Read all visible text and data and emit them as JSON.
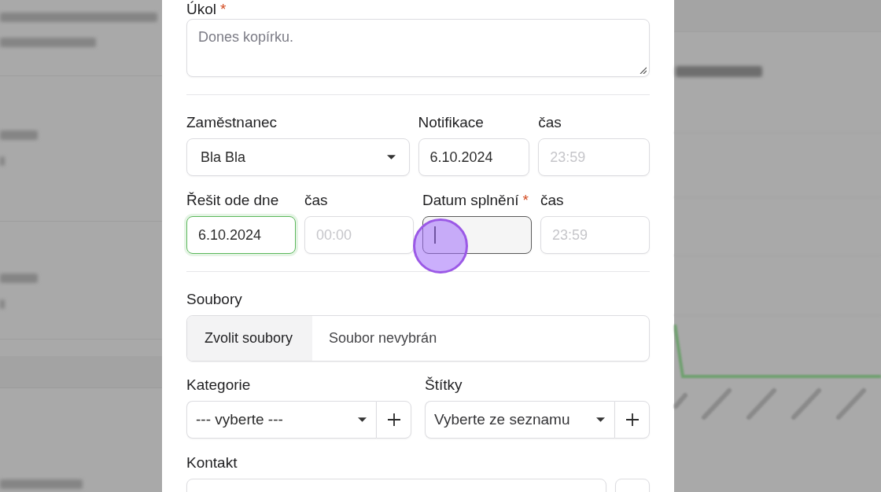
{
  "dialog": {
    "task": {
      "label": "Úkol",
      "required_mark": "*",
      "placeholder": "Dones kopírku."
    },
    "date_rows": [
      {
        "fields": [
          {
            "kind": "select",
            "label": "Zaměstnanec",
            "value": "Bla Bla",
            "valid": false,
            "focused": false,
            "click_highlight": false
          },
          {
            "kind": "date",
            "label": "Notifikace",
            "value": "6.10.2024",
            "valid": false,
            "focused": false,
            "click_highlight": false
          },
          {
            "kind": "time",
            "label": "čas",
            "placeholder": "23:59",
            "valid": false,
            "focused": false,
            "click_highlight": false
          }
        ]
      },
      {
        "fields": [
          {
            "kind": "date",
            "label": "Řešit ode dne",
            "value": "6.10.2024",
            "valid": true,
            "focused": false,
            "click_highlight": false
          },
          {
            "kind": "time",
            "label": "čas",
            "placeholder": "00:00",
            "valid": false,
            "focused": false,
            "click_highlight": false
          },
          {
            "kind": "date",
            "label": "Datum splnění",
            "required_mark": "*",
            "valid": false,
            "focused": true,
            "click_highlight": true
          },
          {
            "kind": "time",
            "label": "čas",
            "placeholder": "23:59",
            "valid": false,
            "focused": false,
            "click_highlight": false
          }
        ]
      }
    ],
    "files": {
      "label": "Soubory",
      "button": "Zvolit soubory",
      "status": "Soubor nevybrán"
    },
    "pickers": [
      {
        "label": "Kategorie",
        "value": "--- vyberte ---"
      },
      {
        "label": "Štítky",
        "placeholder": "Vyberte ze seznamu"
      }
    ],
    "contact": {
      "label": "Kontakt"
    }
  }
}
